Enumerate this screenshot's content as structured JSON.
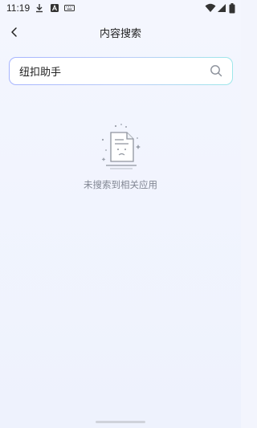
{
  "status_bar": {
    "time": "11:19",
    "icons": [
      "download-icon",
      "a-icon",
      "keyboard-icon",
      "wifi-icon",
      "signal-icon",
      "battery-icon"
    ]
  },
  "header": {
    "back_icon": "chevron-left-icon",
    "title": "内容搜索"
  },
  "search": {
    "value": "纽扣助手",
    "icon": "search-icon"
  },
  "empty_state": {
    "illustration": "empty-document-icon",
    "message": "未搜索到相关应用"
  },
  "colors": {
    "background": "#f3f5fd",
    "search_border_start": "#a6b4ff",
    "search_border_end": "#9de7ea",
    "muted_text": "#808592"
  }
}
